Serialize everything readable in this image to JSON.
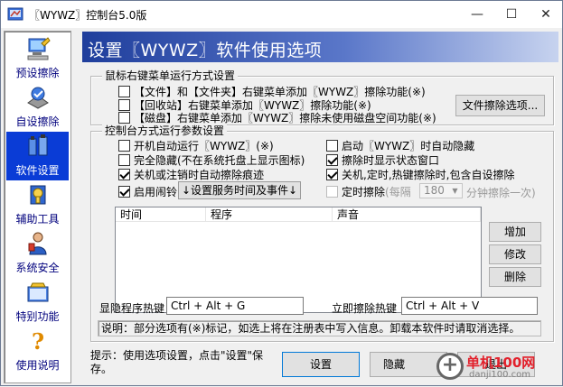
{
  "window": {
    "title": "〖WYWZ〗控制台5.0版",
    "min_glyph": "—",
    "max_glyph": "☐",
    "close_glyph": "✕"
  },
  "sidebar": {
    "items": [
      {
        "label": "预设擦除",
        "icon": "preset-erase-icon",
        "active": false
      },
      {
        "label": "自设擦除",
        "icon": "custom-erase-icon",
        "active": false
      },
      {
        "label": "软件设置",
        "icon": "software-settings-icon",
        "active": true
      },
      {
        "label": "辅助工具",
        "icon": "tools-icon",
        "active": false
      },
      {
        "label": "系统安全",
        "icon": "security-icon",
        "active": false
      },
      {
        "label": "特别功能",
        "icon": "special-feature-icon",
        "active": false
      },
      {
        "label": "使用说明",
        "icon": "help-icon",
        "active": false
      }
    ]
  },
  "banner": {
    "title": "设置〖WYWZ〗软件使用选项"
  },
  "context_menu_group": {
    "legend": "鼠标右键菜单运行方式设置",
    "options": [
      {
        "label": "【文件】和【文件夹】右键菜单添加〖WYWZ〗擦除功能(※)",
        "checked": false
      },
      {
        "label": "【回收站】右键菜单添加〖WYWZ〗擦除功能(※)",
        "checked": false
      },
      {
        "label": "【磁盘】右键菜单添加〖WYWZ〗擦除未使用磁盘空间功能(※)",
        "checked": false
      }
    ],
    "file_erase_button": "文件擦除选项..."
  },
  "console_group": {
    "legend": "控制台方式运行参数设置",
    "left_options": [
      {
        "label": "开机自动运行〖WYWZ〗(※)",
        "checked": false
      },
      {
        "label": "完全隐藏(不在系统托盘上显示图标)",
        "checked": false
      },
      {
        "label": "关机或注销时自动擦除痕迹",
        "checked": true
      },
      {
        "label": "启用闹铃",
        "checked": true
      }
    ],
    "alarm_button": "↓设置服务时间及事件↓",
    "right_options": [
      {
        "label": "启动〖WYWZ〗时自动隐藏",
        "checked": false
      },
      {
        "label": "擦除时显示状态窗口",
        "checked": true
      },
      {
        "label": "关机,定时,热键擦除时,包含自设擦除",
        "checked": true
      }
    ],
    "timed_erase": {
      "label": "定时擦除",
      "prefix": "(每隔",
      "interval": "180",
      "suffix": "分钟擦除一次)",
      "checked": false
    },
    "table": {
      "columns": [
        "时间",
        "程序",
        "声音"
      ]
    },
    "buttons": {
      "add": "增加",
      "edit": "修改",
      "delete": "删除"
    },
    "hotkeys": {
      "show_hide_label": "显隐程序热键",
      "show_hide_value": "Ctrl + Alt + G",
      "erase_now_label": "立即擦除热键",
      "erase_now_value": "Ctrl + Alt + V"
    },
    "note": "说明：部分选项有(※)标记，如选上将在注册表中写入信息。卸载本软件时请取消选择。"
  },
  "footer": {
    "hint": "提示：使用选项设置，点击\"设置\"保存。",
    "set_button": "设置",
    "hide_button": "隐藏",
    "exit_button": "退出"
  },
  "watermark": {
    "text": "单机100网",
    "sub": "danji100.com"
  },
  "colors": {
    "active_nav": "#0a3cd6",
    "banner_start": "#1f3e9c",
    "nav_text": "#00007d"
  }
}
